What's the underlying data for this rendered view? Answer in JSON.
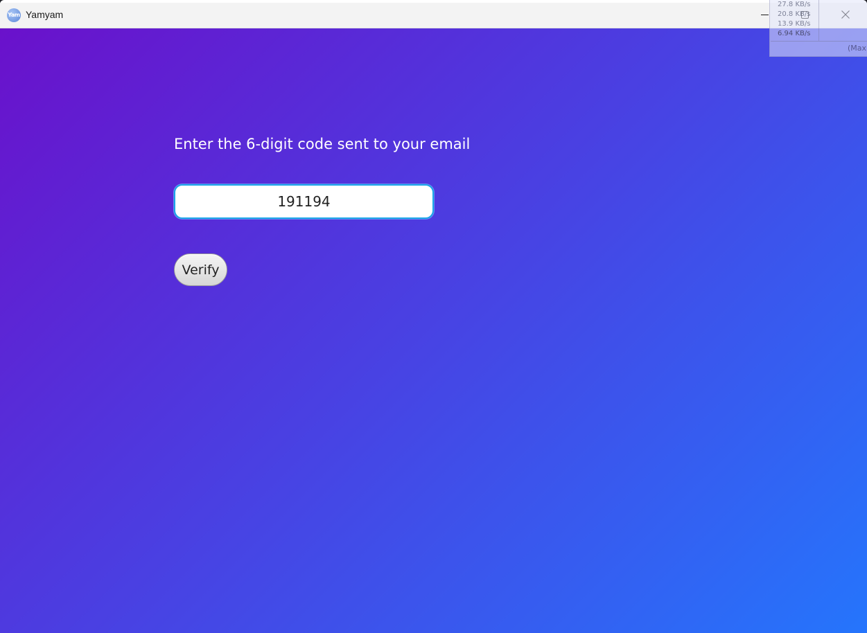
{
  "window": {
    "title": "Yamyam",
    "icon_text": "Yam",
    "minimize_icon": "minimize-icon",
    "maximize_icon": "maximize-icon",
    "close_icon": "close-icon"
  },
  "net_widget": {
    "speeds": [
      "27.8 KB/s",
      "20.8 KB/s",
      "13.9 KB/s",
      "6.94 KB/s"
    ],
    "max_label": "(Max"
  },
  "verification": {
    "prompt": "Enter the 6-digit code sent to your email",
    "code_value": "191194",
    "verify_label": "Verify"
  },
  "colors": {
    "gradient_start": "#6a11cb",
    "gradient_end": "#2575fc",
    "input_border": "#1aa3e8"
  }
}
